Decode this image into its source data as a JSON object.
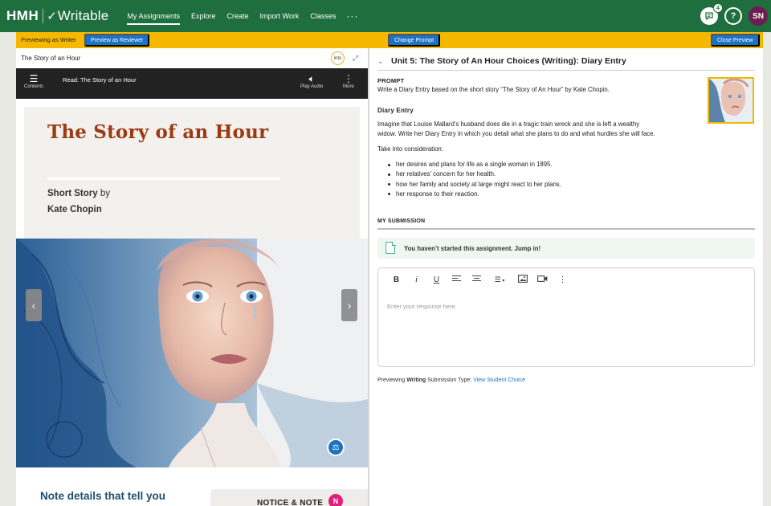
{
  "nav": {
    "brand_hmh": "HMH",
    "brand_name": "Writable",
    "links": [
      "My Assignments",
      "Explore",
      "Create",
      "Import Work",
      "Classes"
    ],
    "more": "···",
    "notifications_count": "4",
    "help_glyph": "?",
    "user_initials": "SN"
  },
  "preview_bar": {
    "mode_label": "Previewing as Writer",
    "preview_reviewer": "Preview as Reviewer",
    "change_prompt": "Change Prompt",
    "close_preview": "Close Preview"
  },
  "reader": {
    "doc_title": "The Story of an Hour",
    "into_badge": "into",
    "contents_label": "Contents",
    "read_label": "Read: The Story of an Hour",
    "play_audio_label": "Play Audio",
    "more_label": "More",
    "story_title": "The Story of an Hour",
    "genre": "Short Story",
    "by": " by",
    "author": "Kate Chopin",
    "note_heading": "Note details that tell you",
    "notice_note": "NOTICE & NOTE",
    "nn_letter": "N"
  },
  "assignment": {
    "title": "Unit 5: The Story of An Hour Choices (Writing): Diary Entry",
    "prompt_label": "PROMPT",
    "prompt_text": "Write a Diary Entry based on the short story “The Story of An Hour” by Kate Chopin.",
    "diary_heading": "Diary Entry",
    "diary_line1": "Imagine that Louise Mallard’s husband does die in a tragic train wreck and she is left a wealthy",
    "diary_line2": "widow. Write her Diary Entry in which you detail what she plans to do and what hurdles she will face.",
    "consider_label": "Take into consideration:",
    "considerations": [
      "her desires and plans for life as a single woman in 1895.",
      "her relatives’ concern for her health.",
      "how her family and society at large might react to her plans.",
      "her response to their reaction."
    ],
    "submission_label": "MY SUBMISSION",
    "not_started": "You haven’t started this assignment. Jump in!",
    "toolbar": {
      "bold": "B",
      "italic": "i",
      "underline": "U",
      "more": "⋮"
    },
    "editor_placeholder": "Enter your response here.",
    "preview_prefix": "Previewing ",
    "submission_type_bold": "Writing",
    "submission_type_suffix": " Submission Type: ",
    "view_choice_link": "View Student Choice"
  },
  "colors": {
    "nav_green": "#1f6e3e",
    "preview_yellow": "#f5b700",
    "button_blue": "#1c72c4",
    "title_rust": "#9c3a12",
    "avatar_plum": "#6e1d52",
    "notice_pink": "#e0207a"
  }
}
